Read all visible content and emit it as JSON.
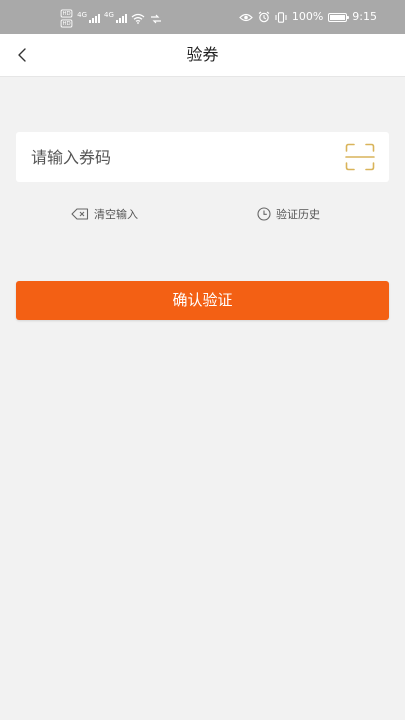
{
  "status_bar": {
    "network_badge_1": "HD",
    "network_badge_2": "HD",
    "network_1": "4G",
    "network_2": "4G",
    "battery_percent": 100,
    "battery_text": "100%",
    "time": "9:15",
    "icons": [
      "signal-icon",
      "wifi-icon",
      "eye-icon",
      "alarm-icon",
      "vibrate-icon",
      "battery-icon"
    ]
  },
  "nav": {
    "title": "验券",
    "back_icon": "chevron-left-icon"
  },
  "code_input": {
    "placeholder": "请输入券码",
    "value": "",
    "scan_icon": "scan-icon"
  },
  "actions": {
    "clear_label": "清空输入",
    "clear_icon": "backspace-icon",
    "history_label": "验证历史",
    "history_icon": "clock-icon"
  },
  "confirm_button": {
    "label": "确认验证"
  },
  "colors": {
    "accent": "#f36014",
    "scan_icon": "#d9b45a",
    "background": "#f2f2f2",
    "status_bar": "#a9a9a9"
  }
}
